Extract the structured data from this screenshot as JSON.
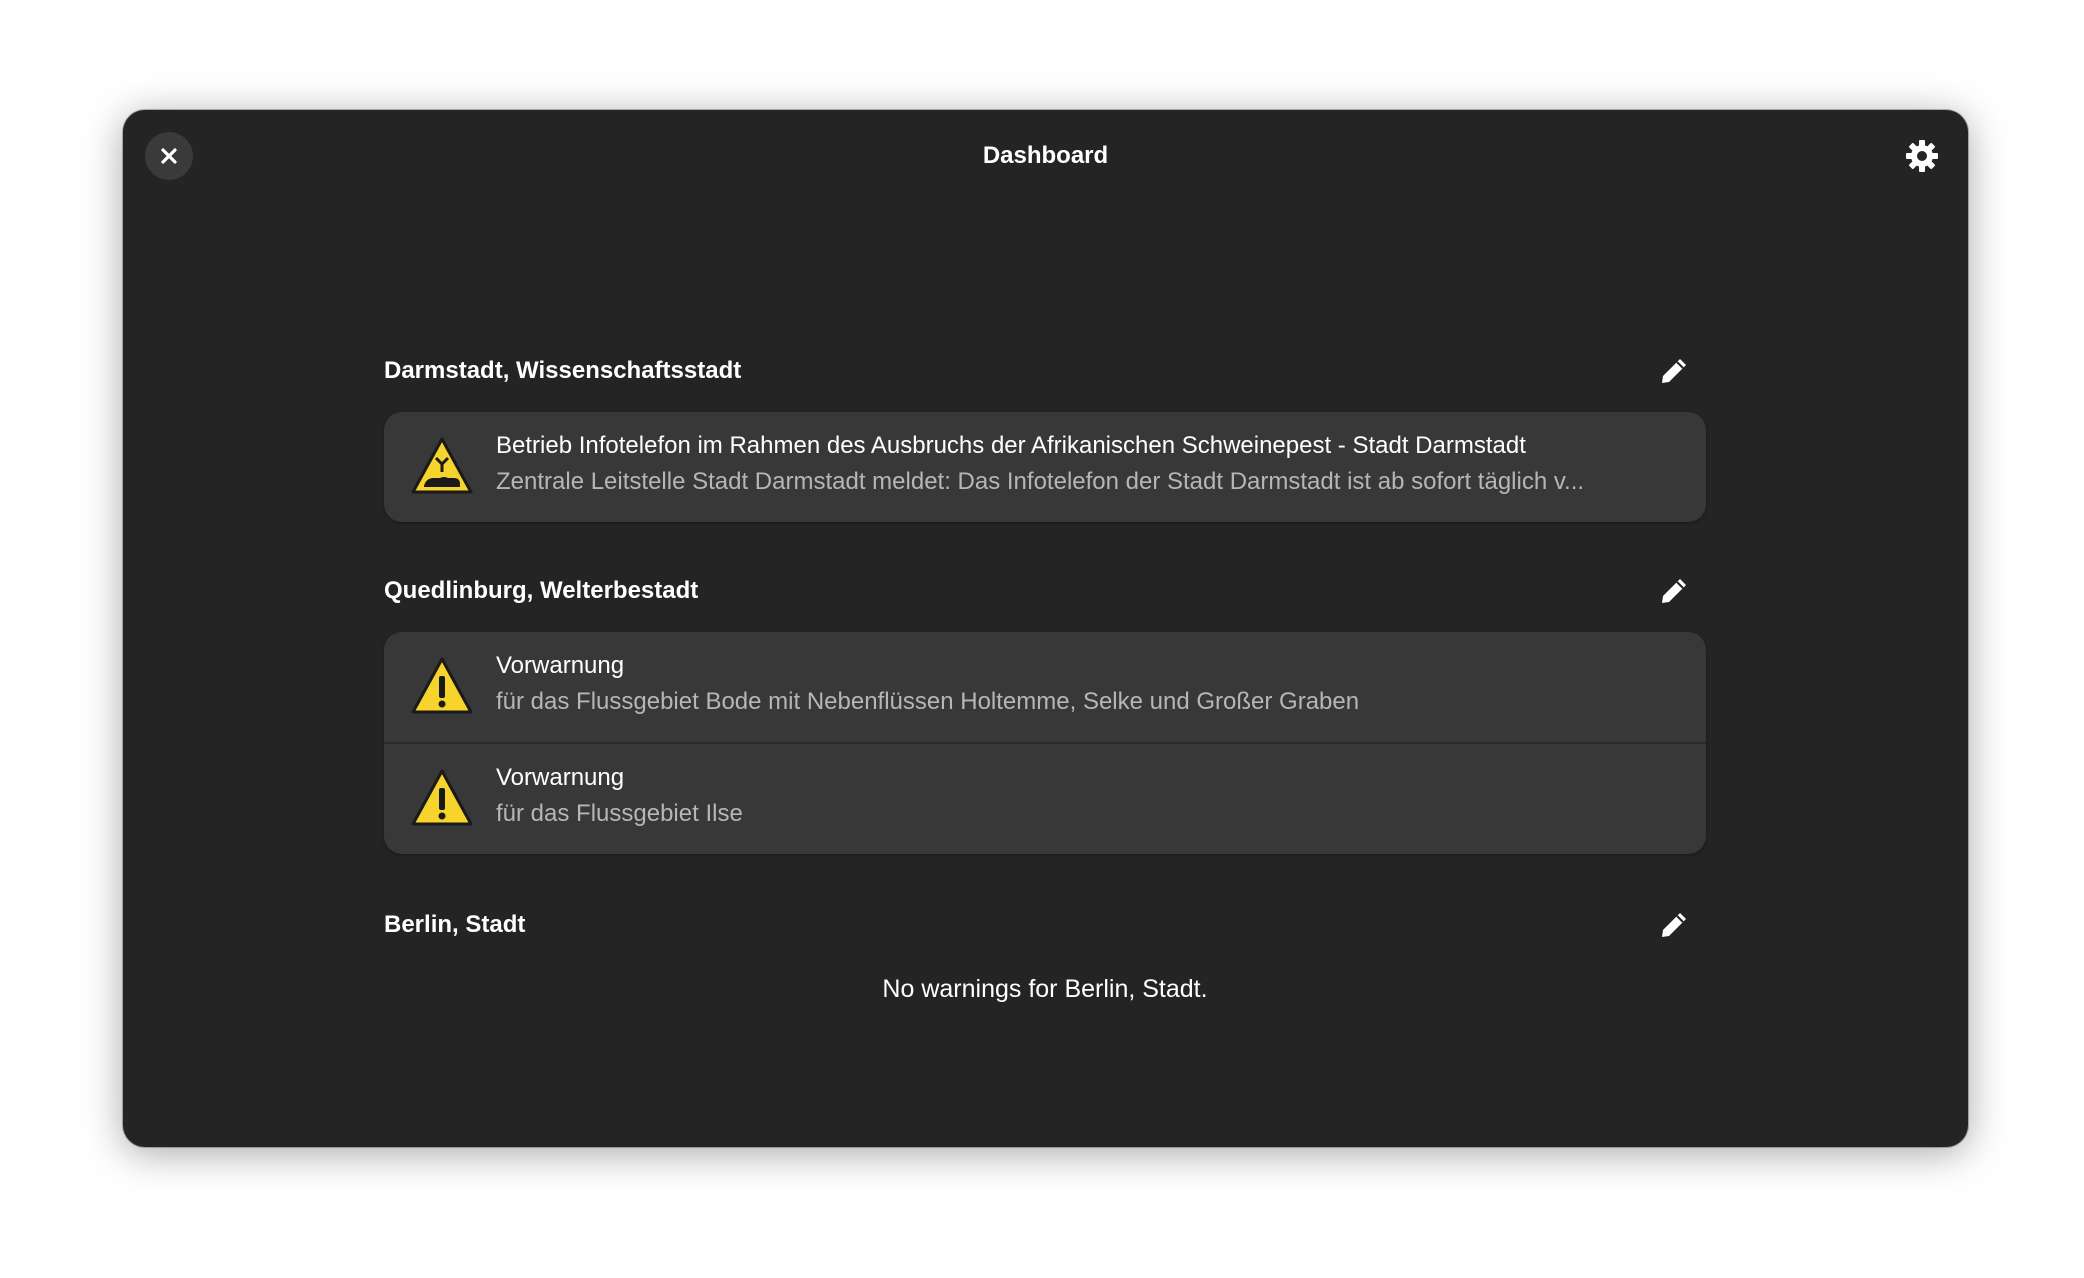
{
  "window": {
    "title": "Dashboard"
  },
  "header": {
    "close_icon": "close-icon",
    "settings_icon": "gear-icon"
  },
  "sections": [
    {
      "name": "Darmstadt, Wissenschaftsstadt",
      "warnings": [
        {
          "icon": "animal-disease-warning-icon",
          "title": "Betrieb Infotelefon im Rahmen des Ausbruchs der Afrikanischen Schweinepest - Stadt Darmstadt",
          "subtitle": "Zentrale Leitstelle Stadt Darmstadt meldet: Das Infotelefon der Stadt Darmstadt ist ab sofort täglich v..."
        }
      ]
    },
    {
      "name": "Quedlinburg, Welterbestadt",
      "warnings": [
        {
          "icon": "warning-icon",
          "title": "Vorwarnung",
          "subtitle": "für das Flussgebiet Bode mit Nebenflüssen Holtemme, Selke und Großer Graben"
        },
        {
          "icon": "warning-icon",
          "title": "Vorwarnung",
          "subtitle": "für das Flussgebiet Ilse"
        }
      ]
    },
    {
      "name": "Berlin, Stadt",
      "empty_text": "No warnings for Berlin, Stadt."
    }
  ],
  "colors": {
    "window_bg": "#242424",
    "card_bg": "#383838",
    "warning_yellow": "#f6d32d"
  }
}
